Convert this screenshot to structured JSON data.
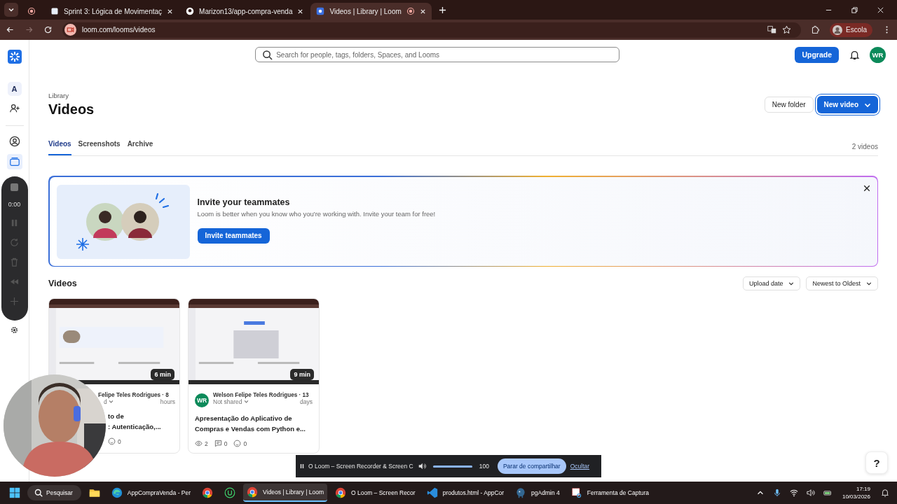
{
  "browser": {
    "tabs": [
      {
        "selected": false
      },
      {
        "title": "Sprint 3: Lógica de Movimentaç",
        "selected": false
      },
      {
        "title": "Marizon13/app-compra-venda",
        "selected": false
      },
      {
        "title": "Videos | Library | Loom",
        "selected": true
      }
    ],
    "address": "loom.com/looms/videos",
    "profile": "Escola"
  },
  "sidebar": {
    "workspace": "A",
    "recorder_time": "0:00"
  },
  "topbar": {
    "search_placeholder": "Search for people, tags, folders, Spaces, and Looms",
    "upgrade": "Upgrade",
    "avatar": "WR"
  },
  "header": {
    "breadcrumb": "Library",
    "title": "Videos",
    "new_folder": "New folder",
    "new_video": "New video"
  },
  "tabs": [
    {
      "label": "Videos",
      "selected": true
    },
    {
      "label": "Screenshots",
      "selected": false
    },
    {
      "label": "Archive",
      "selected": false
    }
  ],
  "count": "2 videos",
  "invite": {
    "title": "Invite your teammates",
    "text": "Loom is better when you know who you're working with. Invite your team for free!",
    "button": "Invite teammates"
  },
  "section_title": "Videos",
  "sorts": [
    "Upload date",
    "Newest to Oldest"
  ],
  "videos": [
    {
      "duration": "6 min",
      "covered": true,
      "author": "Felipe Teles Rodrigues · 8",
      "age": "hours",
      "sharing": "d",
      "title_lines": [
        "to de",
        ": Autenticação,..."
      ],
      "stats": [
        {
          "kind": "reactions",
          "value": "0"
        }
      ]
    },
    {
      "duration": "9 min",
      "covered": false,
      "avatar": "WR",
      "author": "Welson Felipe Teles Rodrigues · 13",
      "age": "days",
      "sharing": "Not shared",
      "title_lines": [
        "Apresentação do Aplicativo de",
        "Compras e Vendas com Python e..."
      ],
      "stats": [
        {
          "kind": "views",
          "value": "2"
        },
        {
          "kind": "comments",
          "value": "0"
        },
        {
          "kind": "reactions",
          "value": "0"
        }
      ]
    }
  ],
  "help": "?",
  "share_bar": {
    "title": "O Loom – Screen Recorder & Screen C",
    "volume": "100",
    "level": 1,
    "stop": "Parar de compartilhar",
    "hide": "Ocultar"
  },
  "taskbar": {
    "search": "Pesquisar",
    "items": [
      {
        "kind": "explorer",
        "selected": false
      },
      {
        "kind": "edge",
        "label": "AppCompraVenda - Per",
        "selected": false
      },
      {
        "kind": "chrome",
        "selected": false
      },
      {
        "kind": "u",
        "selected": false
      },
      {
        "kind": "chrome",
        "label": "Videos | Library | Loom",
        "selected": true
      },
      {
        "kind": "chrome",
        "label": "O Loom – Screen Recor",
        "selected": false
      },
      {
        "kind": "vscode",
        "label": "produtos.html - AppCor",
        "selected": false
      },
      {
        "kind": "pg",
        "label": "pgAdmin 4",
        "selected": false
      },
      {
        "kind": "snip",
        "label": "Ferramenta de Captura",
        "selected": false
      }
    ],
    "time": "17:19",
    "date": "10/03/2026"
  }
}
